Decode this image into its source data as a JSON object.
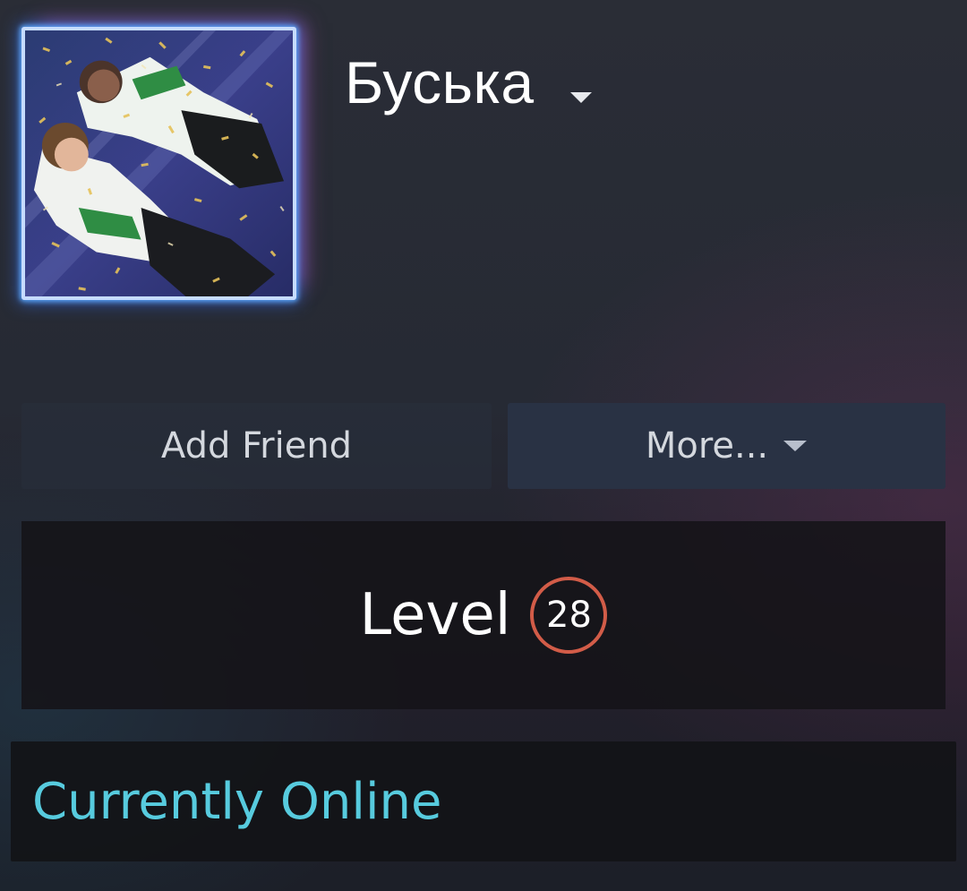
{
  "profile": {
    "persona_name": "Буська",
    "avatar_alt": "profile avatar",
    "avatar_frame_color": "#c6dcff"
  },
  "actions": {
    "add_friend_label": "Add Friend",
    "more_label": "More..."
  },
  "level": {
    "label": "Level",
    "value": "28",
    "badge_color": "#d25c48"
  },
  "status": {
    "text": "Currently Online",
    "color": "#57cbde"
  },
  "icons": {
    "name_dropdown": "chevron-down-icon",
    "more_dropdown": "chevron-down-icon"
  }
}
